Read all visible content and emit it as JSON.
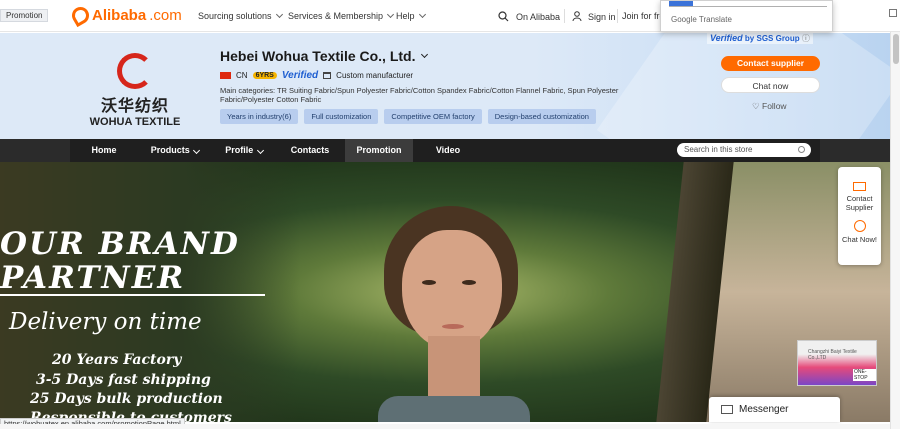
{
  "topbar": {
    "promo_tag": "Promotion",
    "logo_text": "Alibaba",
    "logo_suffix": ".com",
    "nav": [
      "Sourcing solutions",
      "Services & Membership",
      "Help"
    ],
    "on_alibaba": "On Alibaba",
    "sign_in": "Sign in",
    "join": "Join for fre"
  },
  "translate": {
    "label": "Google Translate"
  },
  "company": {
    "logo_cn": "沃华纺织",
    "logo_en": "WOHUA TEXTILE",
    "name": "Hebei Wohua Textile Co., Ltd.",
    "country": "CN",
    "years": "6YRS",
    "verified": "Verified",
    "type": "Custom manufacturer",
    "main_categories": "Main categories: TR Suiting Fabric/Spun Polyester Fabric/Cotton Spandex Fabric/Cotton Flannel Fabric, Spun Polyester Fabric/Polyester Cotton Fabric",
    "tags": [
      "Years in industry(6)",
      "Full customization",
      "Competitive OEM factory",
      "Design-based customization"
    ],
    "sgs_verified": "Verified",
    "sgs_by": "by SGS Group",
    "contact_supplier": "Contact supplier",
    "chat_now": "Chat now",
    "follow": "Follow"
  },
  "storenav": {
    "items": [
      "Home",
      "Products",
      "Profile",
      "Contacts",
      "Promotion",
      "Video"
    ],
    "search_placeholder": "Search in this store"
  },
  "hero": {
    "line1": "OUR BRAND",
    "line2": "PARTNER",
    "delivery": "Delivery on time",
    "bullets": [
      "20 Years Factory",
      "3-5 Days fast shipping",
      "25 Days bulk production",
      "Responsible to customers"
    ]
  },
  "side_widget": {
    "contact": "Contact Supplier",
    "chat": "Chat Now!"
  },
  "ad": {
    "company": "Changzhi Baiyi Textile Co.,LTD",
    "one_stop": "ONE-STOP"
  },
  "messenger": {
    "label": "Messenger"
  },
  "status_url": "https://wohuatex.en.alibaba.com/promotionPage.html",
  "colors": {
    "accent": "#ff6a00",
    "verified": "#1f5fd1",
    "nav_bg": "#1f1f1f"
  }
}
